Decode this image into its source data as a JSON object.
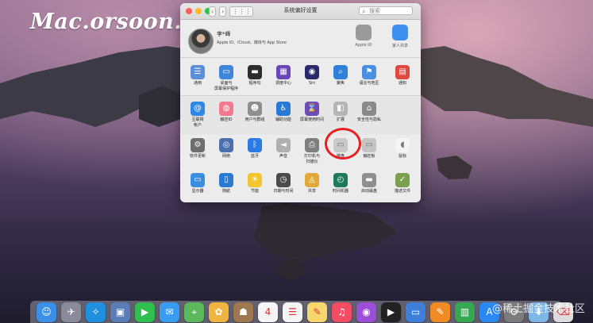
{
  "watermark": "Mac.orsoon.com",
  "dock_watermark": "@稀土掘金技术社区",
  "window": {
    "title": "系统偏好设置",
    "search_placeholder": "搜索",
    "nav_back": "‹",
    "nav_forward": "›",
    "grid_button": "⋮⋮⋮",
    "account": {
      "name": "李*峰",
      "subtitle": "Apple ID、iCloud、媒体与 App Store",
      "items": [
        {
          "label": "Apple ID",
          "icon": "apple-icon",
          "color": "#9a9a9a"
        },
        {
          "label": "家人共享",
          "icon": "family-sharing-icon",
          "color": "#3d8ff0"
        }
      ]
    },
    "rows": [
      [
        {
          "label": "通用",
          "icon": "general-icon",
          "color": "#5b8fd6",
          "glyph": "☰"
        },
        {
          "label": "桌面与\n屏幕保护程序",
          "icon": "desktop-icon",
          "color": "#3f86d8",
          "glyph": "▭"
        },
        {
          "label": "程序坞",
          "icon": "dock-icon",
          "color": "#2d2d2d",
          "glyph": "▬"
        },
        {
          "label": "调度中心",
          "icon": "mission-control-icon",
          "color": "#6b46b8",
          "glyph": "▦"
        },
        {
          "label": "Siri",
          "icon": "siri-icon",
          "color": "#2a2a6a",
          "glyph": "◉"
        },
        {
          "label": "聚焦",
          "icon": "spotlight-icon",
          "color": "#2f80d8",
          "glyph": "⌕"
        },
        {
          "label": "语言与地区",
          "icon": "language-icon",
          "color": "#4a90e2",
          "glyph": "⚑"
        },
        {
          "label": "通知",
          "icon": "notifications-icon",
          "color": "#e0493f",
          "glyph": "▤"
        }
      ],
      [
        {
          "label": "互联网\n帐户",
          "icon": "internet-accounts-icon",
          "color": "#2f88e6",
          "glyph": "@"
        },
        {
          "label": "触控ID",
          "icon": "touch-id-icon",
          "color": "#f27a8e",
          "glyph": "◍"
        },
        {
          "label": "用户与群组",
          "icon": "users-groups-icon",
          "color": "#8f8f8f",
          "glyph": "☻"
        },
        {
          "label": "辅助功能",
          "icon": "accessibility-icon",
          "color": "#2979d6",
          "glyph": "♿"
        },
        {
          "label": "屏幕使用时间",
          "icon": "screen-time-icon",
          "color": "#6c4db8",
          "glyph": "⌛"
        },
        {
          "label": "扩展",
          "icon": "extensions-icon",
          "color": "#b5b5b5",
          "glyph": "◧"
        },
        {
          "label": "安全性与隐私",
          "icon": "security-icon",
          "color": "#8a8a8a",
          "glyph": "⌂"
        }
      ],
      [
        {
          "label": "软件更新",
          "icon": "software-update-icon",
          "color": "#6e6e6e",
          "glyph": "⚙"
        },
        {
          "label": "网络",
          "icon": "network-icon",
          "color": "#4c6fae",
          "glyph": "◎"
        },
        {
          "label": "蓝牙",
          "icon": "bluetooth-icon",
          "color": "#2c7be5",
          "glyph": "ᛒ"
        },
        {
          "label": "声音",
          "icon": "sound-icon",
          "color": "#b0b0b0",
          "glyph": "◄"
        },
        {
          "label": "打印机与\n扫描仪",
          "icon": "printers-icon",
          "color": "#7f7f7f",
          "glyph": "⎙"
        },
        {
          "label": "键盘",
          "icon": "keyboard-icon",
          "color": "#c9c9c9",
          "glyph": "▭"
        },
        {
          "label": "触控板",
          "icon": "trackpad-icon",
          "color": "#c4c4c4",
          "glyph": "▭"
        },
        {
          "label": "鼠标",
          "icon": "mouse-icon",
          "color": "#f4f4f4",
          "glyph": "◖"
        }
      ],
      [
        {
          "label": "显示器",
          "icon": "displays-icon",
          "color": "#3a8ee0",
          "glyph": "▭"
        },
        {
          "label": "随航",
          "icon": "sidecar-icon",
          "color": "#2a7ad4",
          "glyph": "▯"
        },
        {
          "label": "节能",
          "icon": "energy-saver-icon",
          "color": "#f2c531",
          "glyph": "☀"
        },
        {
          "label": "日期与时间",
          "icon": "date-time-icon",
          "color": "#4a4a4a",
          "glyph": "◷"
        },
        {
          "label": "共享",
          "icon": "sharing-icon",
          "color": "#e2a938",
          "glyph": "◬"
        },
        {
          "label": "时间机器",
          "icon": "time-machine-icon",
          "color": "#1f7a5c",
          "glyph": "◴"
        },
        {
          "label": "启动磁盘",
          "icon": "startup-disk-icon",
          "color": "#8e8e8e",
          "glyph": "▬"
        },
        {
          "label": "描述文件",
          "icon": "profiles-icon",
          "color": "#7aa050",
          "glyph": "✓"
        }
      ]
    ]
  },
  "dock": [
    {
      "icon": "finder-icon",
      "color": "#3a8fe6",
      "glyph": "☺"
    },
    {
      "icon": "launchpad-icon",
      "color": "#8a8a9a",
      "glyph": "✈"
    },
    {
      "icon": "safari-icon",
      "color": "#1f8fe0",
      "glyph": "✧"
    },
    {
      "icon": "preview-icon",
      "color": "#5b7db5",
      "glyph": "▣"
    },
    {
      "icon": "facetime-icon",
      "color": "#2fbf4f",
      "glyph": "▶"
    },
    {
      "icon": "messages-icon",
      "color": "#3a9cf0",
      "glyph": "✉"
    },
    {
      "icon": "maps-icon",
      "color": "#5cb85c",
      "glyph": "⌖"
    },
    {
      "icon": "photos-icon",
      "color": "#f2b441",
      "glyph": "✿"
    },
    {
      "icon": "contacts-icon",
      "color": "#a07850",
      "glyph": "☗"
    },
    {
      "icon": "calendar-icon",
      "color": "#f5f5f5",
      "glyph": "4"
    },
    {
      "icon": "reminders-icon",
      "color": "#f4f4f4",
      "glyph": "☰"
    },
    {
      "icon": "notes-icon",
      "color": "#f5d76e",
      "glyph": "✎"
    },
    {
      "icon": "music-icon",
      "color": "#f24d64",
      "glyph": "♫"
    },
    {
      "icon": "podcasts-icon",
      "color": "#9b4fd6",
      "glyph": "◉"
    },
    {
      "icon": "tv-icon",
      "color": "#222222",
      "glyph": "▶"
    },
    {
      "icon": "keynote-icon",
      "color": "#3d7fd9",
      "glyph": "▭"
    },
    {
      "icon": "pages-icon",
      "color": "#f08a24",
      "glyph": "✎"
    },
    {
      "icon": "numbers-icon",
      "color": "#36a852",
      "glyph": "▥"
    },
    {
      "icon": "app-store-icon",
      "color": "#2a88f0",
      "glyph": "A"
    },
    {
      "icon": "system-preferences-icon",
      "color": "#7c7c7c",
      "glyph": "⚙"
    },
    {
      "icon": "downloads-folder-icon",
      "color": "#7fb6e8",
      "glyph": "⬇"
    },
    {
      "icon": "trash-icon",
      "color": "#dcdcdc",
      "glyph": "⌫"
    }
  ]
}
